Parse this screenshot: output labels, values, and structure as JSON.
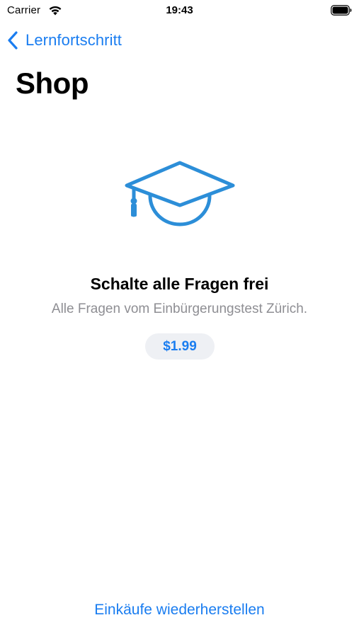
{
  "status_bar": {
    "carrier": "Carrier",
    "time": "19:43",
    "wifi_icon": "wifi-icon",
    "battery_icon": "battery-icon"
  },
  "nav": {
    "back_label": "Lernfortschritt",
    "back_icon": "chevron-left-icon"
  },
  "page": {
    "title": "Shop"
  },
  "product": {
    "icon": "graduation-cap-icon",
    "title": "Schalte alle Fragen frei",
    "description": "Alle Fragen vom Einbürgerungstest Zürich.",
    "price": "$1.99"
  },
  "footer": {
    "restore_label": "Einkäufe wiederherstellen"
  },
  "colors": {
    "accent": "#1a7df0",
    "icon": "#2c8ed8",
    "secondary_text": "#8e8e93",
    "price_background": "#eef0f4"
  }
}
